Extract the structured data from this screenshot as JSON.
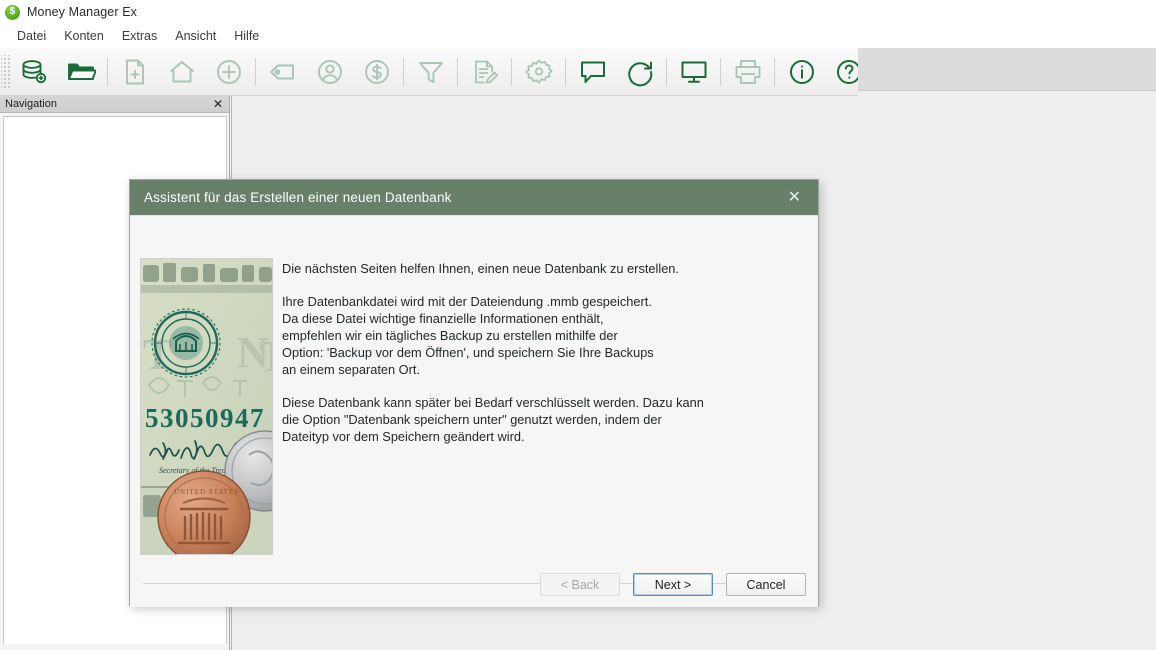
{
  "window": {
    "app_icon": "dollar-circle-icon",
    "app_icon_glyph": "$",
    "title": "Money Manager Ex",
    "background_color": "#eeeeee"
  },
  "menubar": {
    "items": [
      {
        "label": "Datei"
      },
      {
        "label": "Konten"
      },
      {
        "label": "Extras"
      },
      {
        "label": "Ansicht"
      },
      {
        "label": "Hilfe"
      }
    ]
  },
  "toolbar": {
    "enabled_color": "#1a6b38",
    "disabled_color": "#a9c6b2",
    "groups": [
      {
        "buttons": [
          {
            "icon": "new-database-icon",
            "enabled": true
          },
          {
            "icon": "open-folder-icon",
            "enabled": true
          }
        ]
      },
      {
        "buttons": [
          {
            "icon": "new-document-icon",
            "enabled": false
          },
          {
            "icon": "home-icon",
            "enabled": false
          },
          {
            "icon": "add-circle-icon",
            "enabled": false
          }
        ]
      },
      {
        "buttons": [
          {
            "icon": "tag-icon",
            "enabled": false
          },
          {
            "icon": "user-circle-icon",
            "enabled": false
          },
          {
            "icon": "dollar-circle-icon",
            "enabled": false
          }
        ]
      },
      {
        "buttons": [
          {
            "icon": "filter-funnel-icon",
            "enabled": false
          }
        ]
      },
      {
        "buttons": [
          {
            "icon": "edit-list-icon",
            "enabled": false
          }
        ]
      },
      {
        "buttons": [
          {
            "icon": "gear-icon",
            "enabled": false
          }
        ]
      },
      {
        "buttons": [
          {
            "icon": "speech-bubble-icon",
            "enabled": true
          },
          {
            "icon": "refresh-circle-icon",
            "enabled": true
          }
        ]
      },
      {
        "buttons": [
          {
            "icon": "monitor-icon",
            "enabled": true
          }
        ]
      },
      {
        "buttons": [
          {
            "icon": "printer-icon",
            "enabled": false
          }
        ]
      },
      {
        "buttons": [
          {
            "icon": "info-circle-icon",
            "enabled": true
          },
          {
            "icon": "help-circle-icon",
            "enabled": true
          }
        ]
      }
    ]
  },
  "navigation_panel": {
    "title": "Navigation",
    "close_label": "✕",
    "items": []
  },
  "dialog": {
    "title": "Assistent für das Erstellen einer neuen Datenbank",
    "title_bar_color": "#68806a",
    "close_label": "✕",
    "image": {
      "name": "us-currency-photo",
      "serial_number": "53050947",
      "signature_caption": "Secretary of the Treasury"
    },
    "paragraphs": [
      "Die nächsten Seiten helfen Ihnen, einen neue Datenbank zu erstellen.",
      "Ihre Datenbankdatei wird mit der Dateiendung .mmb gespeichert.\nDa diese Datei wichtige finanzielle Informationen enthält,\nempfehlen wir ein tägliches Backup zu erstellen mithilfe der\nOption: 'Backup vor dem Öffnen', und speichern Sie Ihre Backups\nan einem separaten Ort.",
      "Diese Datenbank kann später bei Bedarf verschlüsselt werden. Dazu kann\ndie Option \"Datenbank speichern unter\" genutzt werden, indem der\nDateityp vor dem Speichern geändert wird."
    ],
    "buttons": {
      "back": {
        "label": "< Back",
        "state": "disabled"
      },
      "next": {
        "label": "Next >",
        "state": "default"
      },
      "cancel": {
        "label": "Cancel",
        "state": "normal"
      }
    }
  }
}
